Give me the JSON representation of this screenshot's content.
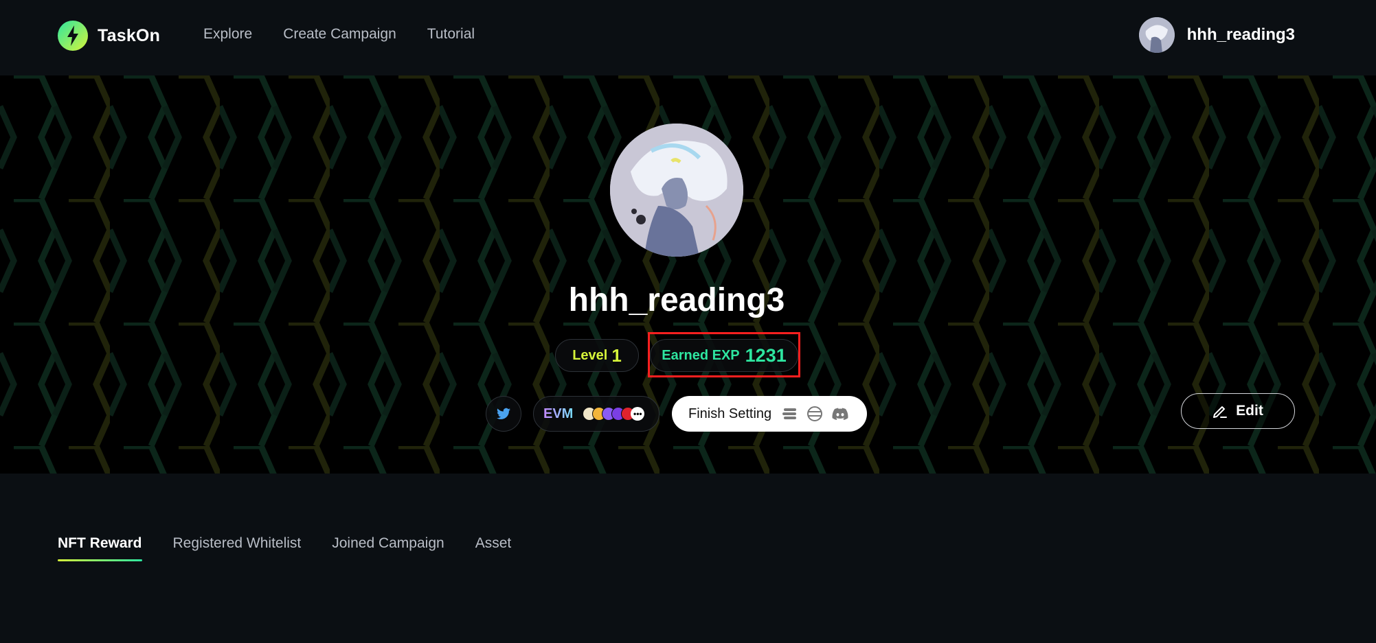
{
  "brand": {
    "name": "TaskOn",
    "accent": "#d6f43a",
    "accent_green": "#2ee6a0"
  },
  "nav": {
    "items": [
      "Explore",
      "Create Campaign",
      "Tutorial"
    ]
  },
  "user": {
    "name": "hhh_reading3"
  },
  "profile": {
    "name": "hhh_reading3",
    "level_label": "Level",
    "level_value": "1",
    "exp_label": "Earned EXP",
    "exp_value": "1231",
    "wallet_label": "EVM",
    "more_glyph": "•••",
    "finish_label": "Finish Setting",
    "edit_label": "Edit"
  },
  "tabs": [
    {
      "label": "NFT Reward",
      "active": true
    },
    {
      "label": "Registered Whitelist",
      "active": false
    },
    {
      "label": "Joined Campaign",
      "active": false
    },
    {
      "label": "Asset",
      "active": false
    }
  ],
  "icons": {
    "twitter": "twitter-icon",
    "edit": "pencil-icon",
    "discord": "discord-icon"
  }
}
